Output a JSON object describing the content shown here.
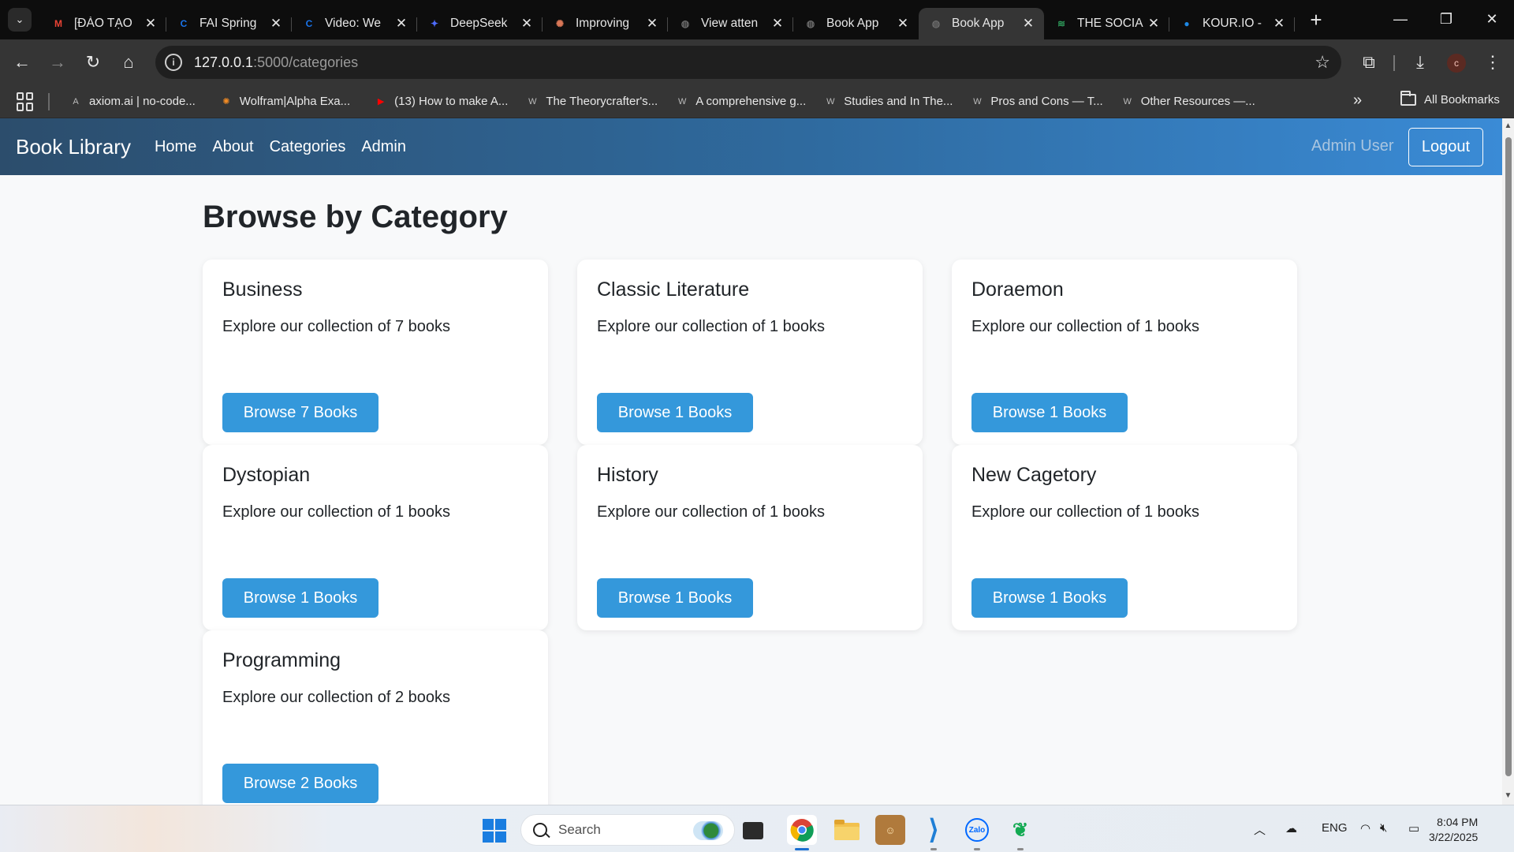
{
  "browser": {
    "tabs": [
      {
        "title": "[ĐÀO TẠO",
        "fav_text": "M",
        "fav_color": "#ea4335",
        "active": false
      },
      {
        "title": "FAI Spring",
        "fav_text": "C",
        "fav_color": "#1a73e8",
        "active": false
      },
      {
        "title": "Video: We",
        "fav_text": "C",
        "fav_color": "#1a73e8",
        "active": false
      },
      {
        "title": "DeepSeek",
        "fav_text": "✦",
        "fav_color": "#4d6bfe",
        "active": false
      },
      {
        "title": "Improving",
        "fav_text": "✺",
        "fav_color": "#d97757",
        "active": false
      },
      {
        "title": "View atten",
        "fav_text": "◍",
        "fav_color": "#6a6a6a",
        "active": false
      },
      {
        "title": "Book App",
        "fav_text": "◍",
        "fav_color": "#6a6a6a",
        "active": false
      },
      {
        "title": "Book App",
        "fav_text": "◍",
        "fav_color": "#6a6a6a",
        "active": true
      },
      {
        "title": "THE SOCIA",
        "fav_text": "≋",
        "fav_color": "#2e9a5a",
        "active": false
      },
      {
        "title": "KOUR.IO -",
        "fav_text": "●",
        "fav_color": "#1e88e5",
        "active": false
      }
    ],
    "url_host": "127.0.0.1",
    "url_path": ":5000/categories",
    "profile_initial": "c",
    "bookmarks": [
      {
        "label": "axiom.ai | no-code...",
        "icon": "A"
      },
      {
        "label": "Wolfram|Alpha Exa...",
        "icon": "✺"
      },
      {
        "label": "(13) How to make A...",
        "icon": "▶"
      },
      {
        "label": "The Theorycrafter's...",
        "icon": "W"
      },
      {
        "label": "A comprehensive g...",
        "icon": "W"
      },
      {
        "label": "Studies and In The...",
        "icon": "W"
      },
      {
        "label": "Pros and Cons — T...",
        "icon": "W"
      },
      {
        "label": "Other Resources —...",
        "icon": "W"
      }
    ],
    "all_bookmarks": "All Bookmarks"
  },
  "site": {
    "brand": "Book Library",
    "nav": [
      "Home",
      "About",
      "Categories",
      "Admin"
    ],
    "user": "Admin User",
    "logout": "Logout",
    "title": "Browse by Category",
    "accent_color": "#3498db",
    "categories": [
      {
        "name": "Business",
        "description": "Explore our collection of 7 books",
        "button": "Browse 7 Books"
      },
      {
        "name": "Classic Literature",
        "description": "Explore our collection of 1 books",
        "button": "Browse 1 Books"
      },
      {
        "name": "Doraemon",
        "description": "Explore our collection of 1 books",
        "button": "Browse 1 Books"
      },
      {
        "name": "Dystopian",
        "description": "Explore our collection of 1 books",
        "button": "Browse 1 Books"
      },
      {
        "name": "History",
        "description": "Explore our collection of 1 books",
        "button": "Browse 1 Books"
      },
      {
        "name": "New Cagetory",
        "description": "Explore our collection of 1 books",
        "button": "Browse 1 Books"
      },
      {
        "name": "Programming",
        "description": "Explore our collection of 2 books",
        "button": "Browse 2 Books"
      }
    ]
  },
  "taskbar": {
    "search_placeholder": "Search",
    "language": "ENG",
    "time": "8:04 PM",
    "date": "3/22/2025"
  }
}
